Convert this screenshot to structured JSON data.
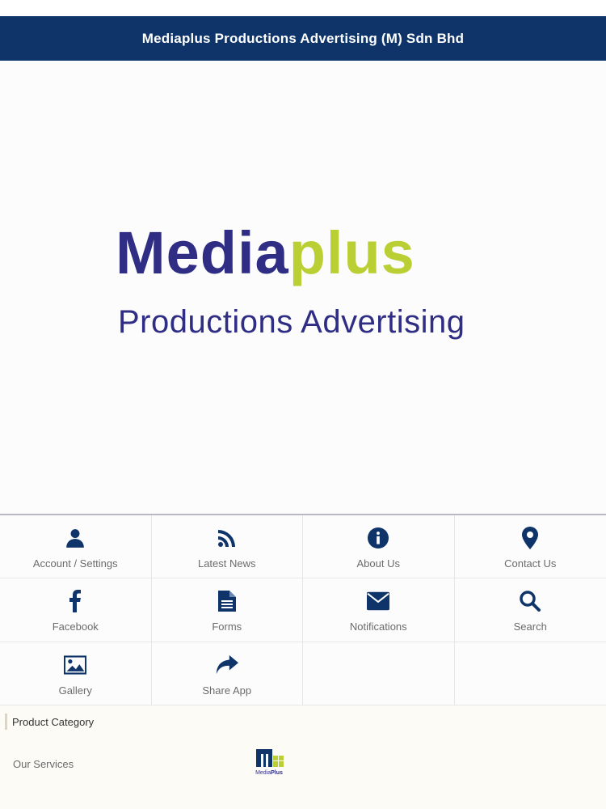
{
  "header": {
    "title": "Mediaplus Productions Advertising (M) Sdn Bhd"
  },
  "hero": {
    "logo_part1": "Media",
    "logo_part2": "plus",
    "logo_sub": "Productions Advertising"
  },
  "menu": [
    {
      "label": "Account / Settings",
      "icon": "user-icon"
    },
    {
      "label": "Latest News",
      "icon": "rss-icon"
    },
    {
      "label": "About Us",
      "icon": "info-icon"
    },
    {
      "label": "Contact Us",
      "icon": "map-pin-icon"
    },
    {
      "label": "Facebook",
      "icon": "facebook-icon"
    },
    {
      "label": "Forms",
      "icon": "document-icon"
    },
    {
      "label": "Notifications",
      "icon": "envelope-icon"
    },
    {
      "label": "Search",
      "icon": "search-icon"
    },
    {
      "label": "Gallery",
      "icon": "image-icon"
    },
    {
      "label": "Share App",
      "icon": "share-icon"
    }
  ],
  "footer": {
    "category_label": "Product Category",
    "services_label": "Our Services",
    "mini_logo_text_1": "Media",
    "mini_logo_text_2": "Plus"
  },
  "colors": {
    "header_bg": "#0e3469",
    "icon": "#0e3469",
    "brand_blue": "#2f2d84",
    "brand_green": "#b9cf33"
  }
}
